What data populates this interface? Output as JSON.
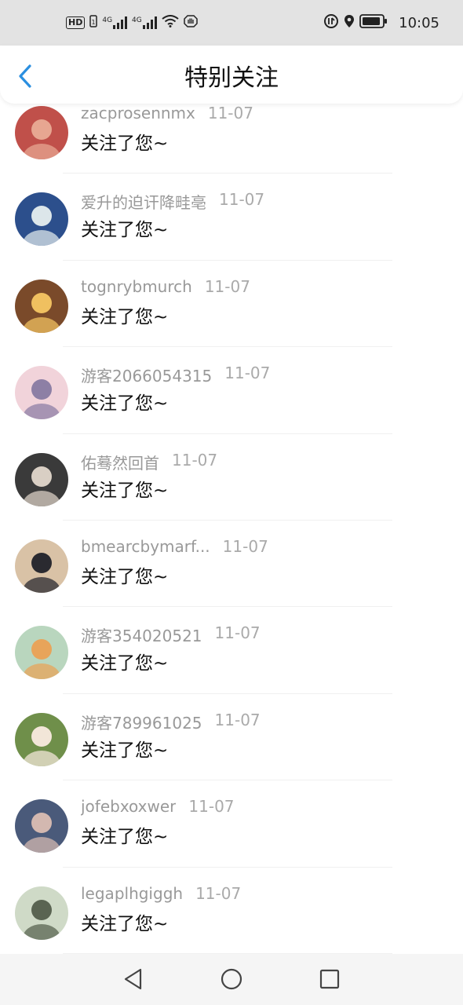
{
  "status_bar": {
    "badge": "HD",
    "signal1_label": "4G",
    "signal2_label": "4G",
    "time": "10:05"
  },
  "header": {
    "back_icon": "chevron-left-icon",
    "title": "特别关注",
    "accent_color": "#2b8fe0"
  },
  "items": [
    {
      "username": "zacprosennmx",
      "date": "11-07",
      "message": "关注了您~",
      "avatar_color": "#c0504a",
      "avatar_accent": "#e7a691"
    },
    {
      "username": "爱升的迫讦降畦亳",
      "date": "11-07",
      "message": "关注了您~",
      "avatar_color": "#2c4f8c",
      "avatar_accent": "#dce6ea"
    },
    {
      "username": "tognrybmurch",
      "date": "11-07",
      "message": "关注了您~",
      "avatar_color": "#7a4a2a",
      "avatar_accent": "#f0c060"
    },
    {
      "username": "游客2066054315",
      "date": "11-07",
      "message": "关注了您~",
      "avatar_color": "#f1d3da",
      "avatar_accent": "#8d7fa5"
    },
    {
      "username": "佑蓦然回首",
      "date": "11-07",
      "message": "关注了您~",
      "avatar_color": "#3a3a3a",
      "avatar_accent": "#d9cfc4"
    },
    {
      "username": "bmearcbymarf...",
      "date": "11-07",
      "message": "关注了您~",
      "avatar_color": "#d9c2a6",
      "avatar_accent": "#2a2a30"
    },
    {
      "username": "游客354020521",
      "date": "11-07",
      "message": "关注了您~",
      "avatar_color": "#b9d6be",
      "avatar_accent": "#e8a45a"
    },
    {
      "username": "游客789961025",
      "date": "11-07",
      "message": "关注了您~",
      "avatar_color": "#6f8f4a",
      "avatar_accent": "#f2e6d8"
    },
    {
      "username": "jofebxoxwer",
      "date": "11-07",
      "message": "关注了您~",
      "avatar_color": "#4a5a7a",
      "avatar_accent": "#d3b8b0"
    },
    {
      "username": "legaplhgiggh",
      "date": "11-07",
      "message": "关注了您~",
      "avatar_color": "#cfdac7",
      "avatar_accent": "#5a6452"
    }
  ],
  "nav_bar": {
    "back_icon": "triangle-back-icon",
    "home_icon": "circle-home-icon",
    "recent_icon": "square-recent-icon"
  }
}
